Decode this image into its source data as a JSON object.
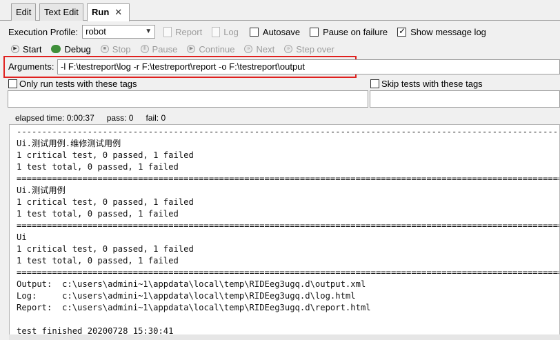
{
  "tabs": [
    {
      "label": "Edit"
    },
    {
      "label": "Text Edit"
    },
    {
      "label": "Run",
      "close": "✕"
    }
  ],
  "profile": {
    "label": "Execution Profile:",
    "value": "robot",
    "report": "Report",
    "log": "Log",
    "autosave": "Autosave",
    "pause_on_failure": "Pause on failure",
    "show_message_log": "Show message log",
    "show_message_log_checked": true
  },
  "controls": {
    "start": "Start",
    "debug": "Debug",
    "stop": "Stop",
    "pause": "Pause",
    "continue": "Continue",
    "next": "Next",
    "step_over": "Step over"
  },
  "arguments": {
    "label": "Arguments:",
    "value": "-l F:\\testreport\\log -r F:\\testreport\\report -o F:\\testreport\\output"
  },
  "tags": {
    "only_run": "Only run tests with these tags",
    "skip": "Skip tests with these tags"
  },
  "status": {
    "elapsed": "elapsed time: 0:00:37",
    "pass": "pass: 0",
    "fail": "fail: 0"
  },
  "console_lines": [
    "------------------------------------------------------------------------------------------------------------------------",
    "Ui.测试用例.维修测试用例",
    "1 critical test, 0 passed, 1 failed",
    "1 test total, 0 passed, 1 failed",
    "========================================================================================================================",
    "Ui.测试用例",
    "1 critical test, 0 passed, 1 failed",
    "1 test total, 0 passed, 1 failed",
    "========================================================================================================================",
    "Ui",
    "1 critical test, 0 passed, 1 failed",
    "1 test total, 0 passed, 1 failed",
    "========================================================================================================================",
    "Output:  c:\\users\\admini~1\\appdata\\local\\temp\\RIDEeg3ugq.d\\output.xml",
    "Log:     c:\\users\\admini~1\\appdata\\local\\temp\\RIDEeg3ugq.d\\log.html",
    "Report:  c:\\users\\admini~1\\appdata\\local\\temp\\RIDEeg3ugq.d\\report.html",
    "",
    "test finished 20200728 15:30:41"
  ]
}
